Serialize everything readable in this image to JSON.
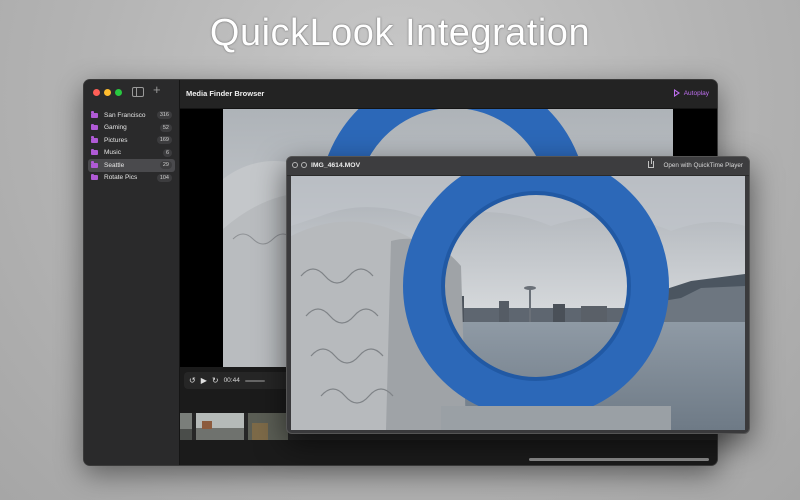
{
  "headline": "QuickLook Integration",
  "window": {
    "title": "Media Finder Browser",
    "autoplay_label": "Autoplay"
  },
  "sidebar": {
    "items": [
      {
        "label": "San Francisco",
        "count": "316"
      },
      {
        "label": "Gaming",
        "count": "52"
      },
      {
        "label": "Pictures",
        "count": "169"
      },
      {
        "label": "Music",
        "count": "6"
      },
      {
        "label": "Seattle",
        "count": "29",
        "selected": true
      },
      {
        "label": "Rotate Pics",
        "count": "104"
      }
    ]
  },
  "player": {
    "time": "00:44"
  },
  "quicklook": {
    "filename": "IMG_4614.MOV",
    "open_with": "Open with QuickTime Player"
  },
  "colors": {
    "accent": "#bf6ff0",
    "folder": "#b05ad6",
    "sculpture_blue": "#2c68b8"
  }
}
